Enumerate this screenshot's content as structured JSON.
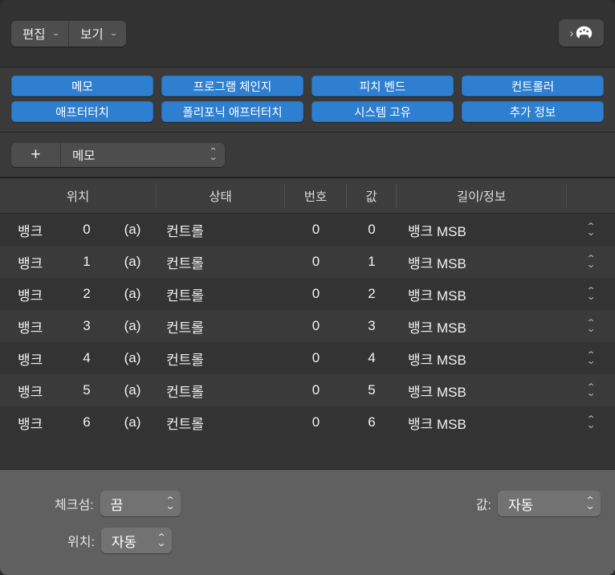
{
  "menubar": {
    "edit_label": "편집",
    "view_label": "보기",
    "chevron_glyph": "⌄",
    "palette_button": {
      "chevron_glyph": "›",
      "icon_name": "palette-icon"
    }
  },
  "event_buttons": {
    "row1": [
      "메모",
      "프로그램 체인지",
      "피치 벤드",
      "컨트롤러"
    ],
    "row2": [
      "애프터터치",
      "폴리포닉 애프터터치",
      "시스템 고유",
      "추가 정보"
    ],
    "accent_color": "#2f7fd0"
  },
  "add_bar": {
    "plus_glyph": "+",
    "selected_type": "메모",
    "stepper_up": "⌃",
    "stepper_down": "⌄"
  },
  "table": {
    "headers": [
      "위치",
      "상태",
      "번호",
      "값",
      "길이/정보",
      ""
    ],
    "rows": [
      {
        "bank": "뱅크",
        "index": "0",
        "paren": "(a)",
        "status": "컨트롤",
        "number": "0",
        "value": "0",
        "length": "뱅크 MSB"
      },
      {
        "bank": "뱅크",
        "index": "1",
        "paren": "(a)",
        "status": "컨트롤",
        "number": "0",
        "value": "1",
        "length": "뱅크 MSB"
      },
      {
        "bank": "뱅크",
        "index": "2",
        "paren": "(a)",
        "status": "컨트롤",
        "number": "0",
        "value": "2",
        "length": "뱅크 MSB"
      },
      {
        "bank": "뱅크",
        "index": "3",
        "paren": "(a)",
        "status": "컨트롤",
        "number": "0",
        "value": "3",
        "length": "뱅크 MSB"
      },
      {
        "bank": "뱅크",
        "index": "4",
        "paren": "(a)",
        "status": "컨트롤",
        "number": "0",
        "value": "4",
        "length": "뱅크 MSB"
      },
      {
        "bank": "뱅크",
        "index": "5",
        "paren": "(a)",
        "status": "컨트롤",
        "number": "0",
        "value": "5",
        "length": "뱅크 MSB"
      },
      {
        "bank": "뱅크",
        "index": "6",
        "paren": "(a)",
        "status": "컨트롤",
        "number": "0",
        "value": "6",
        "length": "뱅크 MSB"
      }
    ]
  },
  "footer": {
    "checksum_label": "체크섬:",
    "checksum_value": "끔",
    "position_label": "위치:",
    "position_value": "자동",
    "value_label": "값:",
    "value_value": "자동",
    "stepper_up": "⌃",
    "stepper_down": "⌄"
  }
}
